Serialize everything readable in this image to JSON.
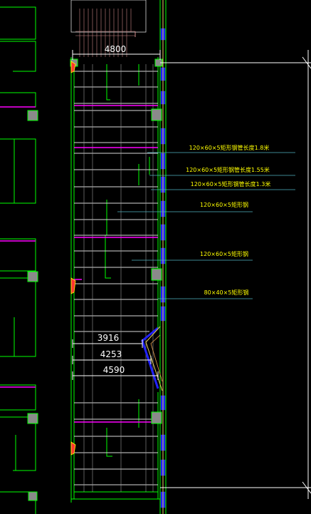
{
  "dimensions": {
    "top_width": "4800",
    "dim_1": "3916",
    "dim_2": "4253",
    "dim_3": "4590"
  },
  "annotations": [
    "120×60×5矩形钢管长度1.8米",
    "120×60×5矩形钢管长度1.55米",
    "120×60×5矩形钢管长度1.3米",
    "120×60×5矩形钢",
    "120×60×5矩形钢",
    "80×40×5矩形钢"
  ],
  "colors": {
    "background": "#000000",
    "wall_green": "#00ff00",
    "beam_white": "#d8d8d8",
    "dimension_white": "#ffffff",
    "note_yellow": "#ffff00",
    "leader_cyan": "#4fb3bf",
    "magenta": "#ff00ff",
    "blue_fill": "#1a1aff",
    "column_gray": "#8a8a8a"
  }
}
